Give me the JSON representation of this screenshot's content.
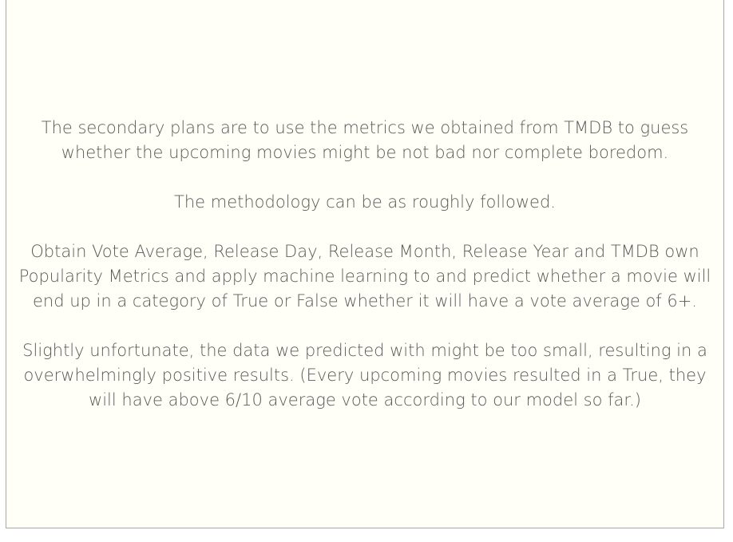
{
  "paragraphs": [
    "The secondary plans are to use the metrics we obtained from TMDB to guess whether the upcoming movies might be not bad nor complete boredom.",
    "The methodology can be as roughly followed.",
    "Obtain Vote Average, Release Day, Release Month, Release Year and TMDB own Popularity Metrics and apply machine learning to and predict whether a movie will end up in a category of True or False whether it will have a vote average of 6+.",
    "Slightly unfortunate, the data we predicted with might be too small, resulting in a overwhelmingly positive results. (Every upcoming movies resulted in a True, they will have above 6/10 average vote according to our model so far.)"
  ]
}
